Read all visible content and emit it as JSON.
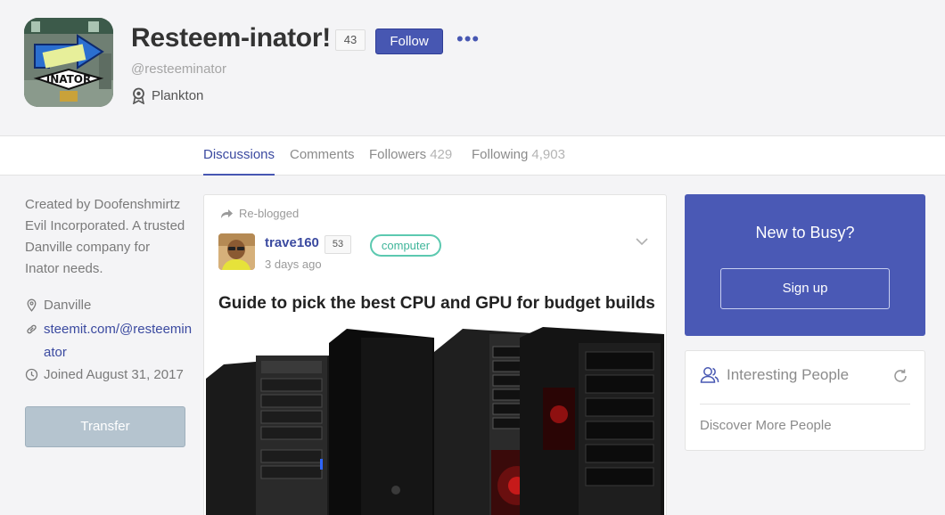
{
  "profile": {
    "name": "Resteem-inator!",
    "reputation": "43",
    "follow_label": "Follow",
    "more_label": "•••",
    "handle": "@resteeminator",
    "rank": "Plankton",
    "avatar_text": "INATOR"
  },
  "tabs": [
    {
      "label": "Discussions",
      "count": ""
    },
    {
      "label": "Comments",
      "count": ""
    },
    {
      "label": "Followers",
      "count": "429"
    },
    {
      "label": "Following",
      "count": "4,903"
    }
  ],
  "sidebar": {
    "about": "Created by Doofenshmirtz Evil Incorporated. A trusted Danville company for Inator needs.",
    "location": "Danville",
    "website": "steemit.com/@resteeminator",
    "joined": "Joined August 31, 2017",
    "transfer_label": "Transfer"
  },
  "post": {
    "reblog_label": "Re-blogged",
    "author": "trave160",
    "author_rep": "53",
    "tag": "computer",
    "time": "3 days ago",
    "title": "Guide to pick the best CPU and GPU for budget builds"
  },
  "busy": {
    "title": "New to Busy?",
    "signup_label": "Sign up"
  },
  "people": {
    "title": "Interesting People",
    "discover_label": "Discover More People"
  },
  "colors": {
    "accent": "#4757b2",
    "tag": "#5cc9b0",
    "transfer": "#b5c4cf"
  }
}
